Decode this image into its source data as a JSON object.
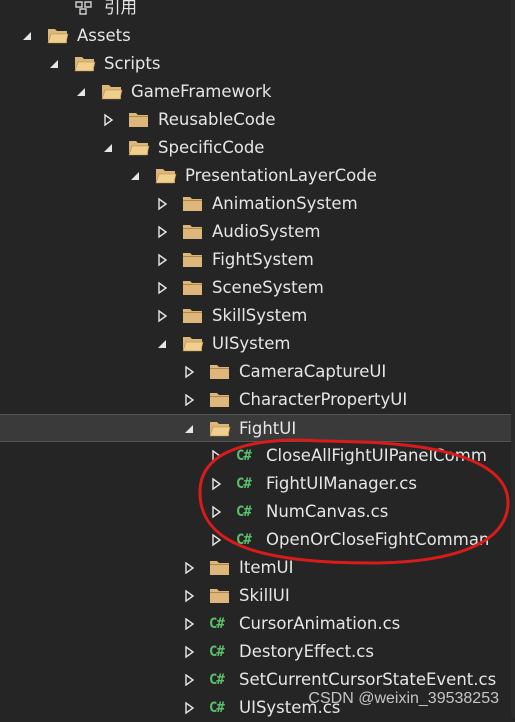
{
  "colors": {
    "background": "#252526",
    "text": "#e6e6e6",
    "folder": "#dcb67a",
    "csharp": "#5cbf6a",
    "annotation": "#d81b1b"
  },
  "tree": [
    {
      "label": "引用",
      "icon": "references-icon",
      "arrow": "none",
      "level": 1
    },
    {
      "label": "Assets",
      "icon": "folder-open-icon",
      "arrow": "expanded",
      "level": 0
    },
    {
      "label": "Scripts",
      "icon": "folder-open-icon",
      "arrow": "expanded",
      "level": 1
    },
    {
      "label": "GameFramework",
      "icon": "folder-open-icon",
      "arrow": "expanded",
      "level": 2
    },
    {
      "label": "ReusableCode",
      "icon": "folder-icon",
      "arrow": "collapsed",
      "level": 3
    },
    {
      "label": "SpecificCode",
      "icon": "folder-open-icon",
      "arrow": "expanded",
      "level": 3
    },
    {
      "label": "PresentationLayerCode",
      "icon": "folder-open-icon",
      "arrow": "expanded",
      "level": 4
    },
    {
      "label": "AnimationSystem",
      "icon": "folder-icon",
      "arrow": "collapsed",
      "level": 5
    },
    {
      "label": "AudioSystem",
      "icon": "folder-icon",
      "arrow": "collapsed",
      "level": 5
    },
    {
      "label": "FightSystem",
      "icon": "folder-icon",
      "arrow": "collapsed",
      "level": 5
    },
    {
      "label": "SceneSystem",
      "icon": "folder-icon",
      "arrow": "collapsed",
      "level": 5
    },
    {
      "label": "SkillSystem",
      "icon": "folder-icon",
      "arrow": "collapsed",
      "level": 5
    },
    {
      "label": "UISystem",
      "icon": "folder-open-icon",
      "arrow": "expanded",
      "level": 5
    },
    {
      "label": "CameraCaptureUI",
      "icon": "folder-icon",
      "arrow": "collapsed",
      "level": 6
    },
    {
      "label": "CharacterPropertyUI",
      "icon": "folder-icon",
      "arrow": "collapsed",
      "level": 6
    },
    {
      "label": "FightUI",
      "icon": "folder-open-icon",
      "arrow": "expanded",
      "level": 6,
      "selected": true
    },
    {
      "label": "CloseAllFightUIPanelComm",
      "icon": "csharp-file-icon",
      "arrow": "collapsed",
      "level": 7
    },
    {
      "label": "FightUIManager.cs",
      "icon": "csharp-file-icon",
      "arrow": "collapsed",
      "level": 7
    },
    {
      "label": "NumCanvas.cs",
      "icon": "csharp-file-icon",
      "arrow": "collapsed",
      "level": 7
    },
    {
      "label": "OpenOrCloseFightComman",
      "icon": "csharp-file-icon",
      "arrow": "collapsed",
      "level": 7
    },
    {
      "label": "ItemUI",
      "icon": "folder-icon",
      "arrow": "collapsed",
      "level": 6
    },
    {
      "label": "SkillUI",
      "icon": "folder-icon",
      "arrow": "collapsed",
      "level": 6
    },
    {
      "label": "CursorAnimation.cs",
      "icon": "csharp-file-icon",
      "arrow": "collapsed",
      "level": 6
    },
    {
      "label": "DestoryEffect.cs",
      "icon": "csharp-file-icon",
      "arrow": "collapsed",
      "level": 6
    },
    {
      "label": "SetCurrentCursorStateEvent.cs",
      "icon": "csharp-file-icon",
      "arrow": "collapsed",
      "level": 6
    },
    {
      "label": "UISystem.cs",
      "icon": "csharp-file-icon",
      "arrow": "collapsed",
      "level": 6
    }
  ],
  "csharp_glyph": "C#",
  "watermark": "CSDN @weixin_39538253"
}
